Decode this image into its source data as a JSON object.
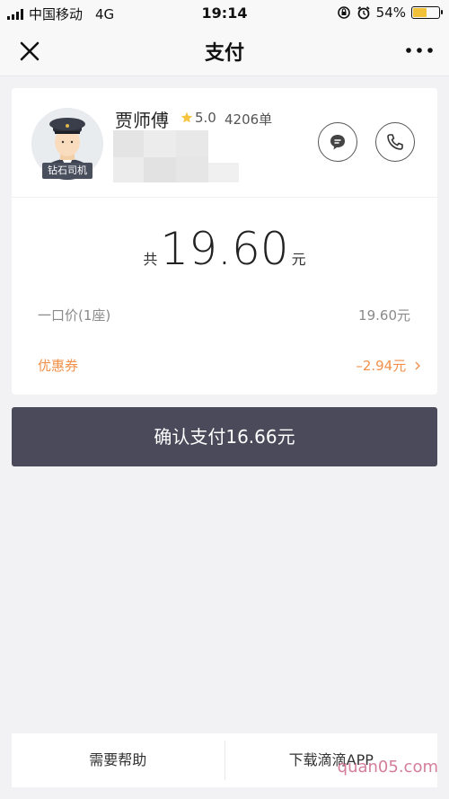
{
  "status_bar": {
    "carrier": "中国移动",
    "network": "4G",
    "time": "19:14",
    "battery": "54%",
    "battery_level": 0.54
  },
  "navbar": {
    "title": "支付"
  },
  "driver": {
    "name": "贾师傅",
    "rating": "5.0",
    "orders": "4206单",
    "badge": "钻石司机"
  },
  "fare": {
    "total_prefix": "共",
    "total_amount": "19.60",
    "total_unit": "元",
    "fixed_price_label": "一口价(1座)",
    "fixed_price_value": "19.60元",
    "coupon_label": "优惠券",
    "coupon_value": "–2.94元"
  },
  "pay_button": {
    "label": "确认支付16.66元"
  },
  "bottom_bar": {
    "help": "需要帮助",
    "download": "下载滴滴APP"
  },
  "watermark": {
    "text": "quan05.com"
  },
  "colors": {
    "accent_orange": "#f0904a",
    "pay_button": "#4a4a5a",
    "battery": "#f2c13a"
  }
}
